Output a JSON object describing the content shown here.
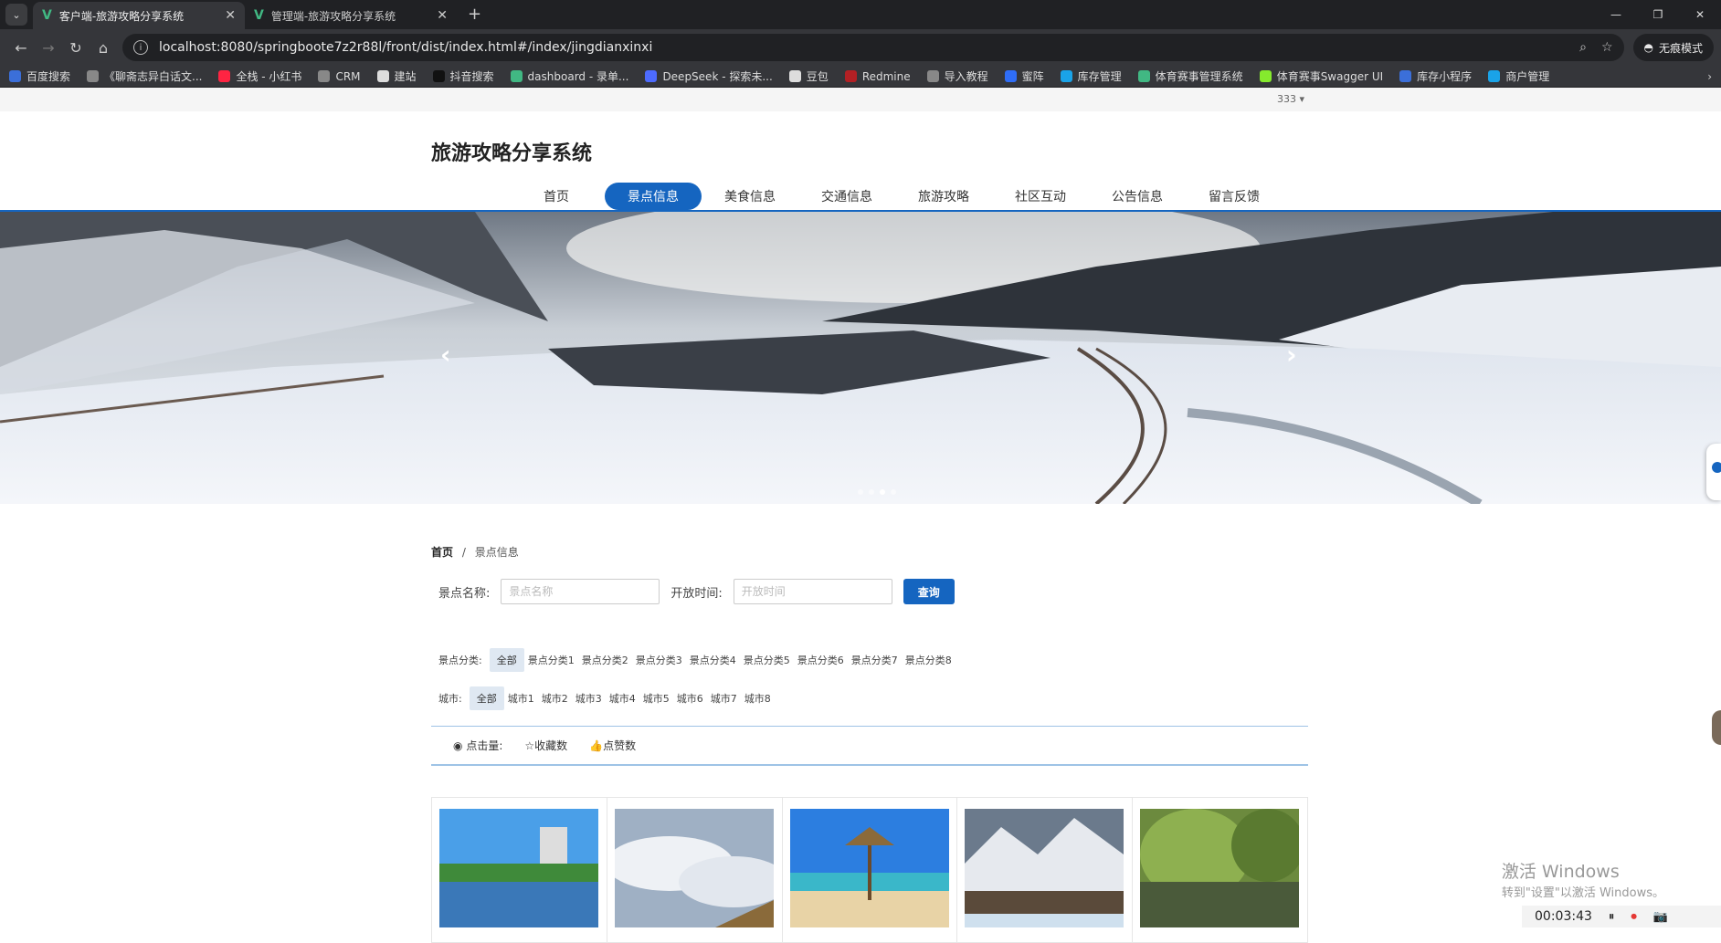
{
  "browser": {
    "tabs": [
      {
        "title": "客户端-旅游攻略分享系统",
        "active": true
      },
      {
        "title": "管理端-旅游攻略分享系统",
        "active": false
      }
    ],
    "url": "localhost:8080/springboote7z2r88l/front/dist/index.html#/index/jingdianxinxi",
    "incognito_label": "无痕模式",
    "bookmarks": [
      {
        "label": "百度搜索",
        "color": "#3b6fd9"
      },
      {
        "label": "《聊斋志异白话文...",
        "color": "#888888"
      },
      {
        "label": "全栈 - 小红书",
        "color": "#ff2442"
      },
      {
        "label": "CRM",
        "color": "#888888"
      },
      {
        "label": "建站",
        "color": "#dddddd"
      },
      {
        "label": "抖音搜索",
        "color": "#111111"
      },
      {
        "label": "dashboard - 录单...",
        "color": "#41b883"
      },
      {
        "label": "DeepSeek - 探索未...",
        "color": "#4d6bfe"
      },
      {
        "label": "豆包",
        "color": "#dddddd"
      },
      {
        "label": "Redmine",
        "color": "#b32024"
      },
      {
        "label": "导入教程",
        "color": "#888888"
      },
      {
        "label": "蜜阵",
        "color": "#2f6df6"
      },
      {
        "label": "库存管理",
        "color": "#1aa3e8"
      },
      {
        "label": "体育赛事管理系统",
        "color": "#41b883"
      },
      {
        "label": "体育赛事Swagger UI",
        "color": "#85ea2d"
      },
      {
        "label": "库存小程序",
        "color": "#3b6fd9"
      },
      {
        "label": "商户管理",
        "color": "#1aa3e8"
      }
    ]
  },
  "page": {
    "user_menu": "333",
    "brand": "旅游攻略分享系统",
    "nav": [
      {
        "label": "首页",
        "active": false
      },
      {
        "label": "景点信息",
        "active": true
      },
      {
        "label": "美食信息",
        "active": false
      },
      {
        "label": "交通信息",
        "active": false
      },
      {
        "label": "旅游攻略",
        "active": false
      },
      {
        "label": "社区互动",
        "active": false
      },
      {
        "label": "公告信息",
        "active": false
      },
      {
        "label": "留言反馈",
        "active": false
      }
    ],
    "breadcrumb": {
      "home": "首页",
      "sep": "/",
      "current": "景点信息"
    },
    "search": {
      "name_label": "景点名称:",
      "name_placeholder": "景点名称",
      "time_label": "开放时间:",
      "time_placeholder": "开放时间",
      "button": "查询"
    },
    "category_filter": {
      "label": "景点分类:",
      "options": [
        "全部",
        "景点分类1",
        "景点分类2",
        "景点分类3",
        "景点分类4",
        "景点分类5",
        "景点分类6",
        "景点分类7",
        "景点分类8"
      ]
    },
    "city_filter": {
      "label": "城市:",
      "options": [
        "全部",
        "城市1",
        "城市2",
        "城市3",
        "城市4",
        "城市5",
        "城市6",
        "城市7",
        "城市8"
      ]
    },
    "sort": [
      "点击量:",
      "收藏数",
      "点赞数"
    ]
  },
  "overlay": {
    "activate_line1": "激活 Windows",
    "activate_line2": "转到\"设置\"以激活 Windows。",
    "recorder_time": "00:03:43"
  },
  "colors": {
    "accent": "#1565c0"
  }
}
